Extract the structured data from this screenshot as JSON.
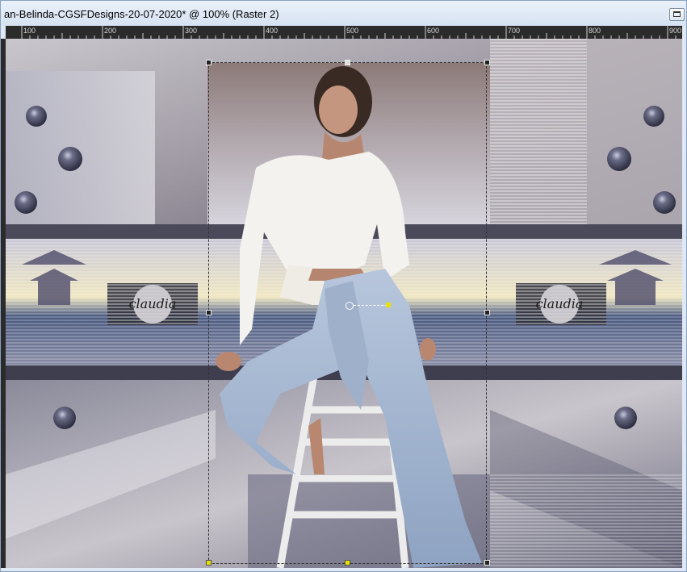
{
  "window": {
    "title": "an-Belinda-CGSFDesigns-20-07-2020* @ 100% (Raster 2)"
  },
  "ruler": {
    "labels": [
      "100",
      "200",
      "300",
      "400",
      "500",
      "600",
      "700",
      "800",
      "900"
    ]
  },
  "watermark": {
    "text": "claudia"
  },
  "colors": {
    "title_bar": "#dfe8f4",
    "ruler_bg": "#2b2b2b",
    "handle_yellow": "#e8e000"
  }
}
